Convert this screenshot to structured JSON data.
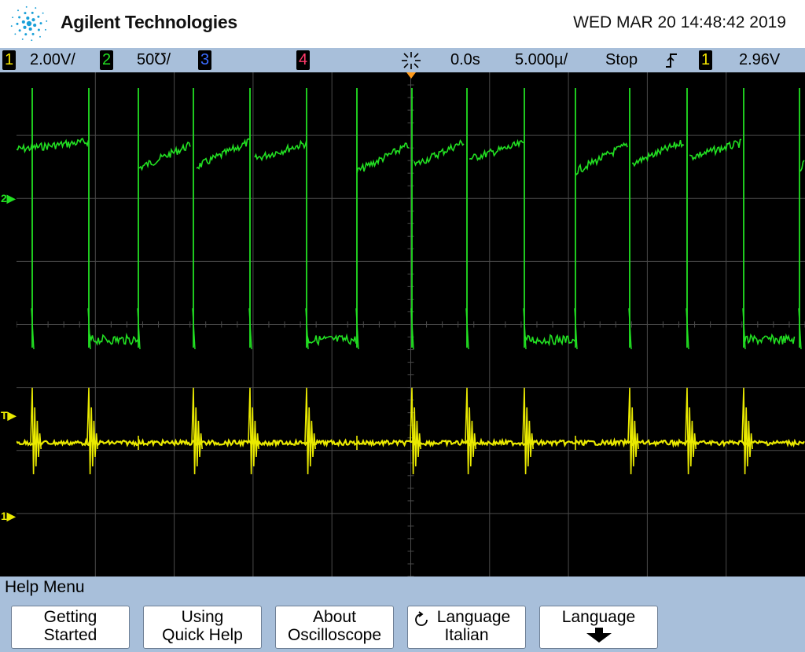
{
  "header": {
    "brand": "Agilent Technologies",
    "datetime": "WED MAR 20 14:48:42 2019"
  },
  "statusbar": {
    "ch1": {
      "num": "1",
      "scale": "2.00V/",
      "color": "#f5e600"
    },
    "ch2": {
      "num": "2",
      "scale": "50℧/",
      "color": "#22e022"
    },
    "ch3": {
      "num": "3",
      "color": "#3a6cff"
    },
    "ch4": {
      "num": "4",
      "color": "#ff3a6a"
    },
    "acq_icon": "acquisition-icon",
    "delay": "0.0s",
    "timebase": "5.000µ/",
    "run_state": "Stop",
    "trigger_slope_icon": "rising-edge-icon",
    "trigger_source": "1",
    "trigger_level": "2.96V"
  },
  "screen": {
    "markers": {
      "ch2_ground": "2",
      "trigger": "T",
      "ch1_ground": "1"
    },
    "colors": {
      "ch1": "#eaea00",
      "ch2": "#22e022",
      "grid": "#4a4a4a"
    }
  },
  "menu": {
    "title": "Help Menu",
    "softkeys": [
      {
        "line1": "Getting",
        "line2": "Started"
      },
      {
        "line1": "Using",
        "line2": "Quick Help"
      },
      {
        "line1": "About",
        "line2": "Oscilloscope"
      },
      {
        "line1": "Language",
        "line2": "Italian",
        "icon": "cycle-icon"
      },
      {
        "line1": "Language",
        "icon": "down-arrow-icon"
      }
    ]
  }
}
